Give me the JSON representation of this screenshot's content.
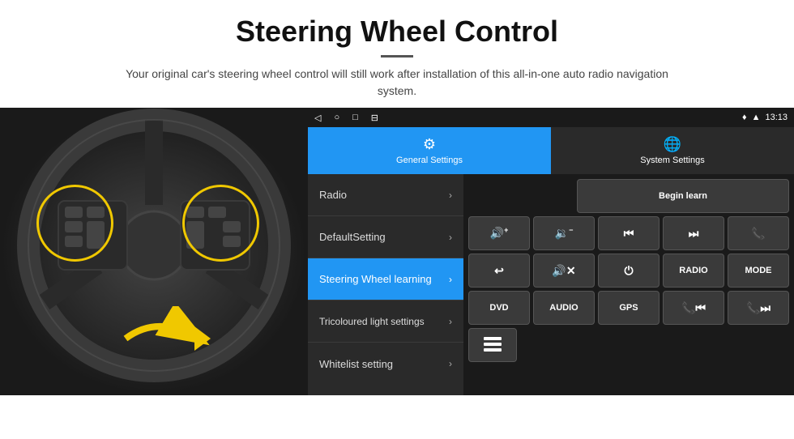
{
  "header": {
    "title": "Steering Wheel Control",
    "divider": true,
    "subtitle": "Your original car's steering wheel control will still work after installation of this all-in-one auto radio navigation system."
  },
  "statusBar": {
    "navIcons": [
      "◁",
      "○",
      "□",
      "⊟"
    ],
    "rightIcons": [
      "♦",
      "▲",
      "13:13"
    ]
  },
  "tabs": [
    {
      "id": "general",
      "label": "General Settings",
      "active": true
    },
    {
      "id": "system",
      "label": "System Settings",
      "active": false
    }
  ],
  "menu": [
    {
      "id": "radio",
      "label": "Radio",
      "active": false
    },
    {
      "id": "default",
      "label": "DefaultSetting",
      "active": false
    },
    {
      "id": "steering",
      "label": "Steering Wheel learning",
      "active": true
    },
    {
      "id": "tricoloured",
      "label": "Tricoloured light settings",
      "active": false
    },
    {
      "id": "whitelist",
      "label": "Whitelist setting",
      "active": false
    }
  ],
  "controls": {
    "beginLearn": "Begin learn",
    "row1": [
      {
        "id": "vol-up",
        "label": "🔊+",
        "type": "icon"
      },
      {
        "id": "vol-down",
        "label": "🔉−",
        "type": "icon"
      },
      {
        "id": "prev-track",
        "label": "⏮",
        "type": "icon"
      },
      {
        "id": "next-track",
        "label": "⏭",
        "type": "icon"
      },
      {
        "id": "phone",
        "label": "📞",
        "type": "icon"
      }
    ],
    "row2": [
      {
        "id": "hang-up",
        "label": "↩",
        "type": "icon"
      },
      {
        "id": "mute",
        "label": "🔊×",
        "type": "icon"
      },
      {
        "id": "power",
        "label": "⏻",
        "type": "icon"
      },
      {
        "id": "radio-btn",
        "label": "RADIO",
        "type": "text"
      },
      {
        "id": "mode-btn",
        "label": "MODE",
        "type": "text"
      }
    ],
    "row3": [
      {
        "id": "dvd",
        "label": "DVD",
        "type": "text"
      },
      {
        "id": "audio",
        "label": "AUDIO",
        "type": "text"
      },
      {
        "id": "gps",
        "label": "GPS",
        "type": "text"
      },
      {
        "id": "phone-prev",
        "label": "📞⏮",
        "type": "icon"
      },
      {
        "id": "phone-next",
        "label": "📞⏭",
        "type": "icon"
      }
    ],
    "row4": [
      {
        "id": "list-icon",
        "label": "≡",
        "type": "icon"
      }
    ]
  }
}
